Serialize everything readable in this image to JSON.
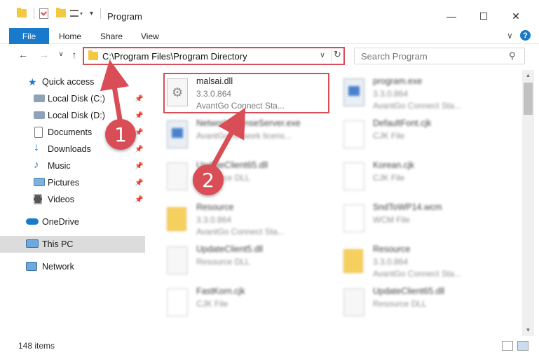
{
  "window": {
    "title": "Program",
    "minimize": "—",
    "maximize": "☐",
    "close": "✕"
  },
  "ribbon": {
    "file_tab": "File",
    "tabs": [
      "Home",
      "Share",
      "View"
    ],
    "expand": "∨",
    "help": "?"
  },
  "address": {
    "path": "C:\\Program Files\\Program Directory",
    "dropdown": "∨",
    "refresh": "↻",
    "back": "←",
    "forward": "→",
    "recent": "∨",
    "up": "↑"
  },
  "search": {
    "placeholder": "Search Program",
    "icon": "⚲"
  },
  "sidebar": {
    "items": [
      {
        "label": "Quick access",
        "icon": "star-icon",
        "pinned": false
      },
      {
        "label": "Local Disk (C:)",
        "icon": "drive-icon",
        "pinned": true
      },
      {
        "label": "Local Disk (D:)",
        "icon": "drive-icon",
        "pinned": true
      },
      {
        "label": "Documents",
        "icon": "documents-icon",
        "pinned": true
      },
      {
        "label": "Downloads",
        "icon": "downloads-icon",
        "pinned": true
      },
      {
        "label": "Music",
        "icon": "music-icon",
        "pinned": true
      },
      {
        "label": "Pictures",
        "icon": "pictures-icon",
        "pinned": true
      },
      {
        "label": "Videos",
        "icon": "videos-icon",
        "pinned": true
      },
      {
        "label": "OneDrive",
        "icon": "cloud-icon",
        "pinned": false
      },
      {
        "label": "This PC",
        "icon": "computer-icon",
        "pinned": false
      },
      {
        "label": "Network",
        "icon": "network-icon",
        "pinned": false
      }
    ],
    "pin_glyph": "📌"
  },
  "files": [
    {
      "name": "malsai.dll",
      "line2": "3.3.0.864",
      "line3": "AvantGo Connect Sta...",
      "type": "dll",
      "highlighted": true
    },
    {
      "name": "program.exe",
      "line2": "3.3.0.864",
      "line3": "AvantGo Connect Sta...",
      "type": "exe"
    },
    {
      "name": "NetworkLicenseServer.exe",
      "line2": "AvantGo network licens...",
      "line3": "",
      "type": "exe"
    },
    {
      "name": "DefaultFont.cjk",
      "line2": "CJK File",
      "line3": "",
      "type": "blank"
    },
    {
      "name": "UpdateClient65.dll",
      "line2": "Resource DLL",
      "line3": "",
      "type": "dll"
    },
    {
      "name": "Korean.cjk",
      "line2": "CJK File",
      "line3": "",
      "type": "blank"
    },
    {
      "name": "Resource",
      "line2": "3.3.0.864",
      "line3": "AvantGo Connect Sta...",
      "type": "folder"
    },
    {
      "name": "SndToWP14.wcm",
      "line2": "WCM File",
      "line3": "",
      "type": "blank"
    },
    {
      "name": "UpdateClient5.dll",
      "line2": "Resource DLL",
      "line3": "",
      "type": "dll"
    },
    {
      "name": "Resource",
      "line2": "3.3.0.864",
      "line3": "AvantGo Connect Sta...",
      "type": "folder"
    },
    {
      "name": "FastKorn.cjk",
      "line2": "CJK File",
      "line3": "",
      "type": "blank"
    },
    {
      "name": "UpdateClient65.dll",
      "line2": "Resource DLL",
      "line3": "",
      "type": "dll"
    }
  ],
  "callouts": [
    "1",
    "2"
  ],
  "status": {
    "item_count": "148 items"
  },
  "colors": {
    "accent": "#1979ca",
    "highlight": "#d94d57",
    "folder": "#f5c842",
    "selected": "#dcdcdc"
  }
}
